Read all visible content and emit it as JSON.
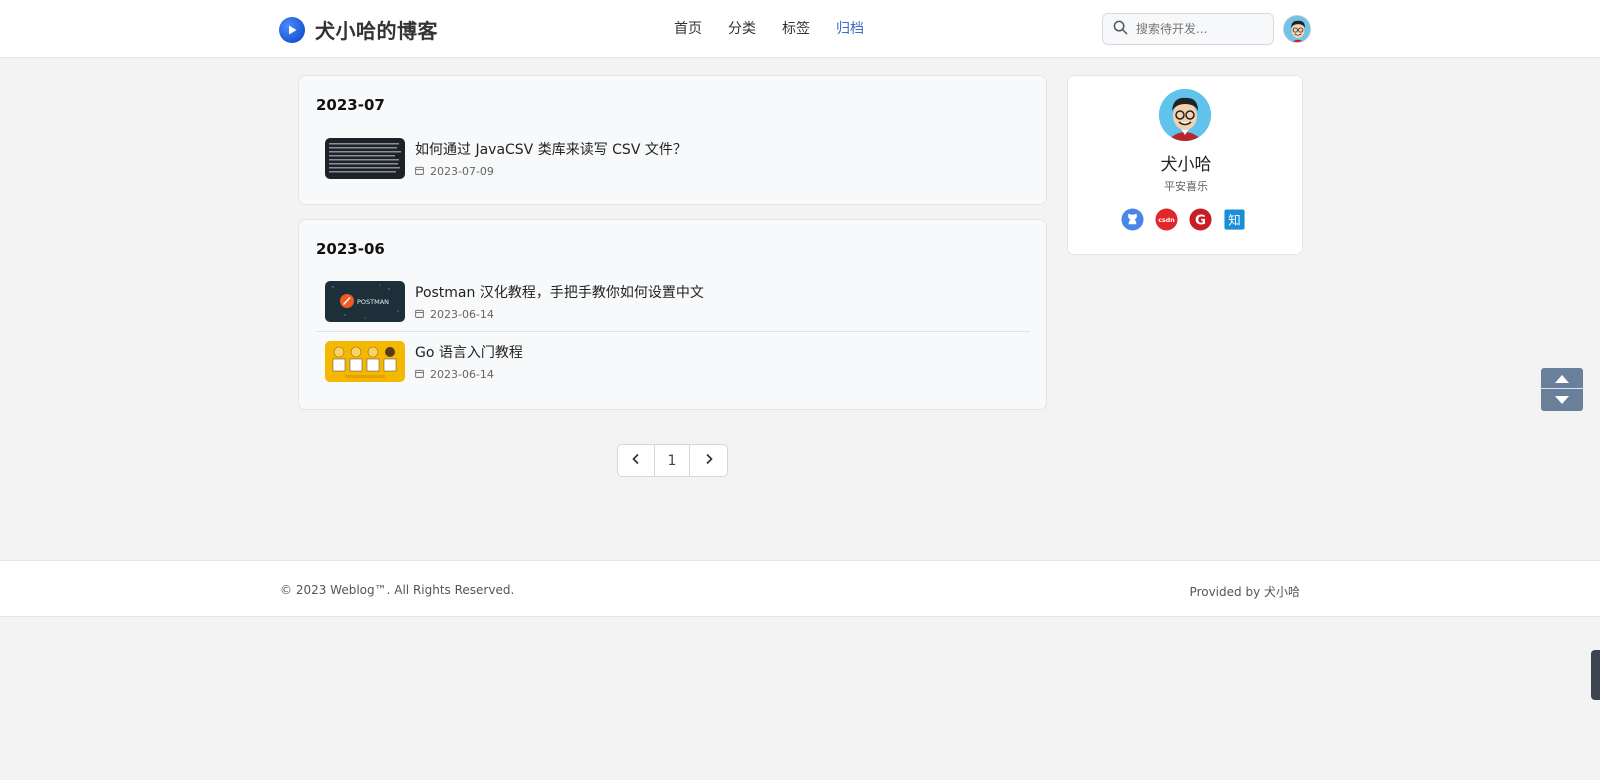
{
  "header": {
    "brand_title": "犬小哈的博客",
    "nav": [
      {
        "label": "首页",
        "active": false
      },
      {
        "label": "分类",
        "active": false
      },
      {
        "label": "标签",
        "active": false
      },
      {
        "label": "归档",
        "active": true
      }
    ],
    "search_placeholder": "搜索待开发...",
    "icons": {
      "logo": "play-logo-icon",
      "search": "search-icon",
      "avatar": "user-avatar"
    }
  },
  "archive": [
    {
      "month": "2023-07",
      "posts": [
        {
          "title": "如何通过 JavaCSV 类库来读写 CSV 文件？",
          "date": "2023-07-09",
          "thumb": "terminal-thumbnail"
        }
      ]
    },
    {
      "month": "2023-06",
      "posts": [
        {
          "title": "Postman 汉化教程，手把手教你如何设置中文",
          "date": "2023-06-14",
          "thumb": "postman-thumbnail",
          "thumb_text": "POSTMAN"
        },
        {
          "title": "Go 语言入门教程",
          "date": "2023-06-14",
          "thumb": "go-thumbnail"
        }
      ]
    }
  ],
  "pagination": {
    "current": "1",
    "prev_icon": "chevron-left-icon",
    "next_icon": "chevron-right-icon"
  },
  "profile": {
    "name": "犬小哈",
    "motto": "平安喜乐",
    "socials": [
      {
        "name": "github",
        "color": "#4a86e8"
      },
      {
        "name": "csdn",
        "color": "#e3262a",
        "text": "csdn"
      },
      {
        "name": "gitee",
        "color": "#c71d23",
        "text": "G"
      },
      {
        "name": "zhihu",
        "color": "#1a8fd8",
        "text": "知"
      }
    ]
  },
  "footer": {
    "copyright": "© 2023 Weblog™. All Rights Reserved.",
    "provided": "Provided by 犬小哈"
  },
  "colors": {
    "accent": "#3a6bc5",
    "scroll_btn": "#6a7f99"
  }
}
